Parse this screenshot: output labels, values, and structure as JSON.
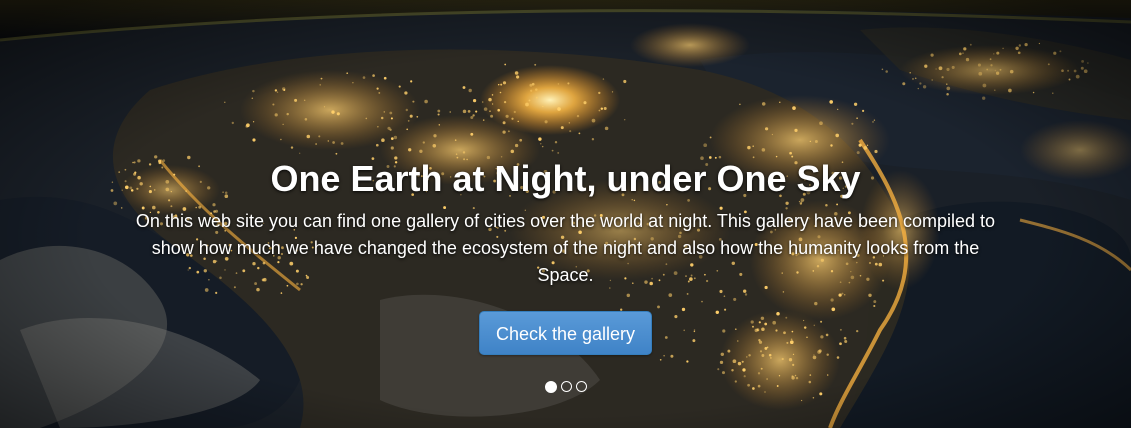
{
  "hero": {
    "title": "One Earth at Night, under One Sky",
    "description": "On this web site you can find one gallery of cities over the world at night. This gallery have been compiled to show how much we have changed the ecosystem of the night and also how the humanity looks from the Space.",
    "button_label": "Check the gallery",
    "background_image": "earth-at-night-from-space"
  },
  "carousel": {
    "active_index": 0,
    "slide_count": 3
  },
  "colors": {
    "button": "#428bca",
    "city_lights": "#ffb640",
    "text": "#ffffff"
  }
}
